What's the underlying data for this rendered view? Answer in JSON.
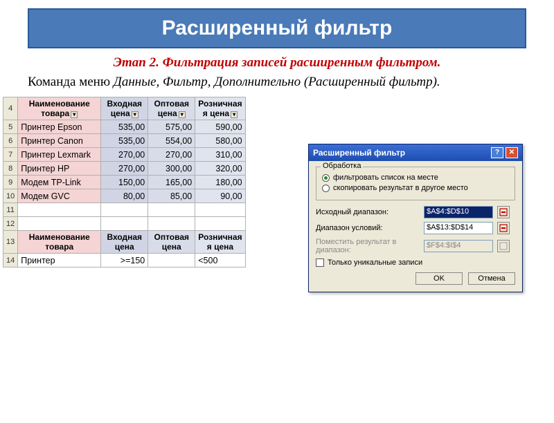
{
  "title": "Расширенный фильтр",
  "stage": "Этап 2. Фильтрация записей расширенным фильтром.",
  "cmd_prefix": "Команда меню ",
  "cmd_italic": "Данные, Фильтр, Дополнительно (Расширенный фильтр).",
  "headers": {
    "name": "Наименование товара",
    "input": "Входная цена",
    "wholesale": "Оптовая цена",
    "retail": "Розничная я цена"
  },
  "rows": [
    {
      "n": "5",
      "name": "Принтер Epson",
      "c1": "535,00",
      "c2": "575,00",
      "c3": "590,00"
    },
    {
      "n": "6",
      "name": "Принтер Canon",
      "c1": "535,00",
      "c2": "554,00",
      "c3": "580,00"
    },
    {
      "n": "7",
      "name": "Принтер Lexmark",
      "c1": "270,00",
      "c2": "270,00",
      "c3": "310,00"
    },
    {
      "n": "8",
      "name": "Принтер HP",
      "c1": "270,00",
      "c2": "300,00",
      "c3": "320,00"
    },
    {
      "n": "9",
      "name": "Модем TP-Link",
      "c1": "150,00",
      "c2": "165,00",
      "c3": "180,00"
    },
    {
      "n": "10",
      "name": "Модем GVC",
      "c1": "80,00",
      "c2": "85,00",
      "c3": "90,00"
    }
  ],
  "row4": "4",
  "row11": "11",
  "row12": "12",
  "row13": "13",
  "row14": "14",
  "criteria": {
    "name": "Принтер",
    "c1": ">=150",
    "c2": "",
    "c3": "<500"
  },
  "dialog": {
    "title": "Расширенный фильтр",
    "group": "Обработка",
    "radio1": "фильтровать список на месте",
    "radio2": "скопировать результат в другое место",
    "src_label": "Исходный диапазон:",
    "crit_label": "Диапазон условий:",
    "out_label": "Поместить результат в диапазон:",
    "src_val": "$A$4:$D$10",
    "crit_val": "$A$13:$D$14",
    "out_val": "$F$4:$I$4",
    "unique": "Только уникальные записи",
    "ok": "OK",
    "cancel": "Отмена"
  }
}
